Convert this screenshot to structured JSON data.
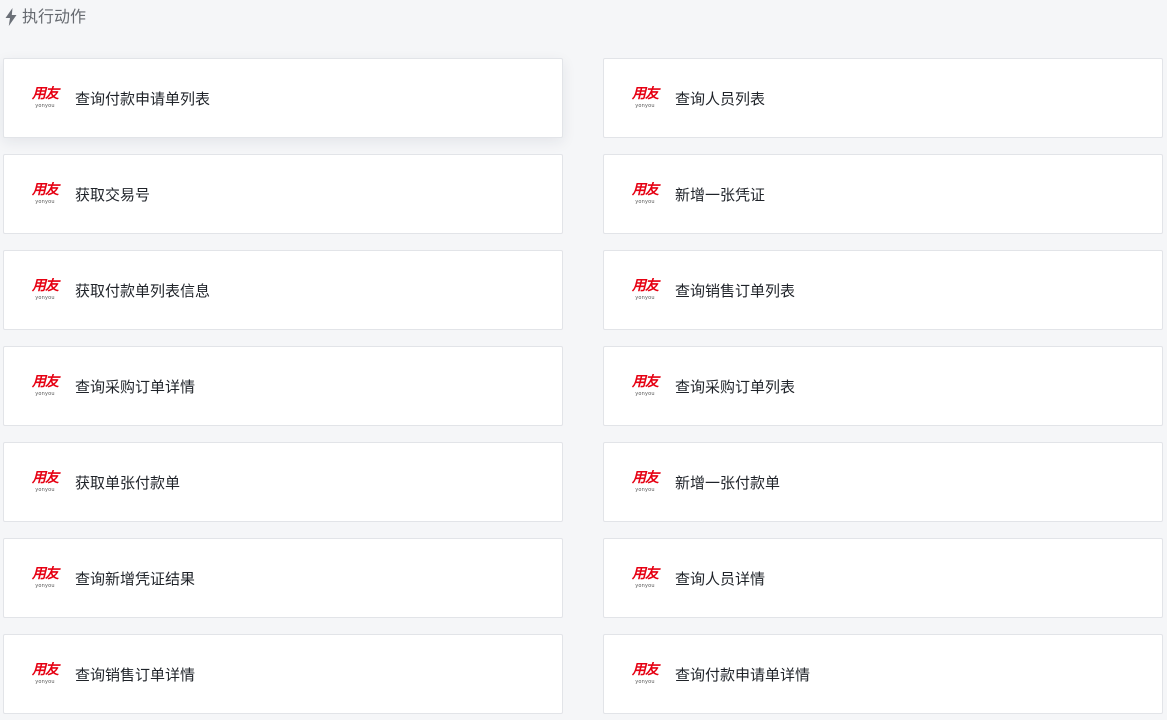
{
  "header": {
    "title": "执行动作",
    "icon": "lightning-bolt-icon"
  },
  "logo": {
    "main": "用友",
    "sub": "yonyou",
    "color": "#e60012"
  },
  "actions": [
    {
      "label": "查询付款申请单列表"
    },
    {
      "label": "查询人员列表"
    },
    {
      "label": "获取交易号"
    },
    {
      "label": "新增一张凭证"
    },
    {
      "label": "获取付款单列表信息"
    },
    {
      "label": "查询销售订单列表"
    },
    {
      "label": "查询采购订单详情"
    },
    {
      "label": "查询采购订单列表"
    },
    {
      "label": "获取单张付款单"
    },
    {
      "label": "新增一张付款单"
    },
    {
      "label": "查询新增凭证结果"
    },
    {
      "label": "查询人员详情"
    },
    {
      "label": "查询销售订单详情"
    },
    {
      "label": "查询付款申请单详情"
    }
  ]
}
